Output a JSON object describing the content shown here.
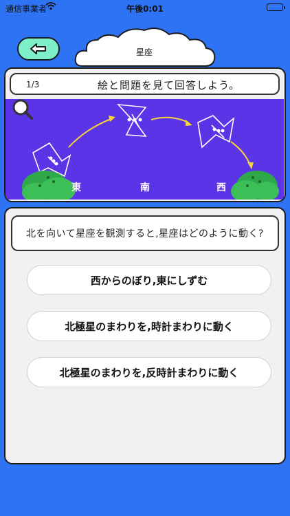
{
  "status_bar": {
    "carrier": "通信事業者",
    "time": "午後0:01"
  },
  "header": {
    "title": "星座"
  },
  "quiz": {
    "progress": "1/3",
    "instruction": "絵と問題を見て回答しよう。",
    "directions": [
      "東",
      "南",
      "西"
    ],
    "question": "北を向いて星座を観測すると,星座はどのように動く?",
    "choices": [
      "西からのぼり,東にしずむ",
      "北極星のまわりを,時計まわりに動く",
      "北極星のまわりを,反時計まわりに動く"
    ]
  },
  "colors": {
    "background": "#2f73f5",
    "sky": "#5a34e6",
    "back_button": "#7ef0c7"
  },
  "icons": [
    "wifi-icon",
    "battery-icon",
    "back-arrow-icon",
    "cloud-shape",
    "magnifier-icon",
    "constellation-icon",
    "arrow-icon",
    "hill-icon"
  ]
}
